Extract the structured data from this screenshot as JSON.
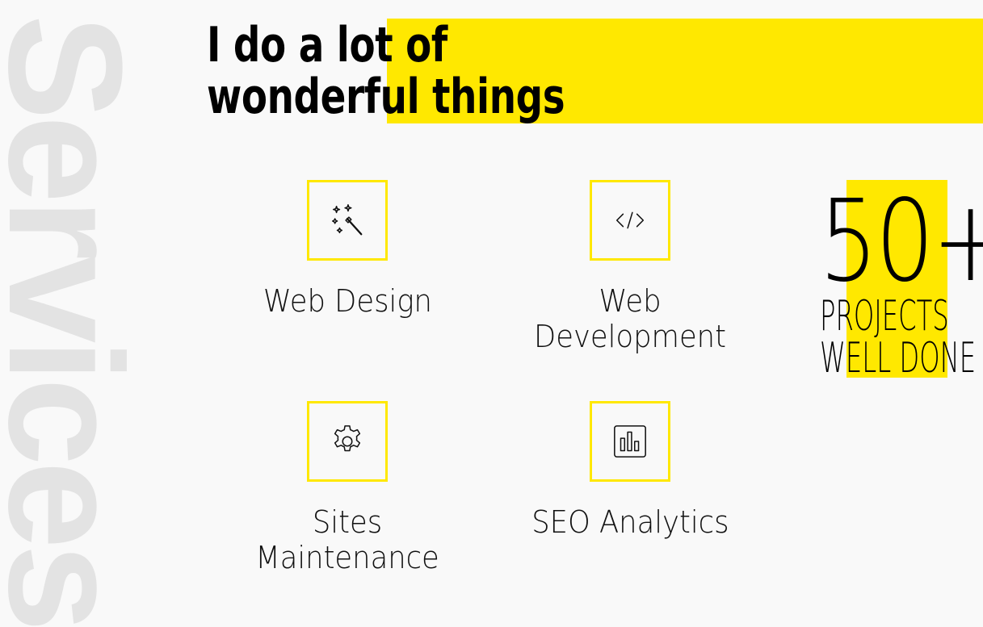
{
  "section": {
    "side_title": "Services",
    "headline": "I do a lot of wonderful things"
  },
  "services": [
    {
      "label": "Web Design",
      "icon": "magic-wand-icon"
    },
    {
      "label": "Web Development",
      "icon": "code-icon"
    },
    {
      "label": "Sites Maintenance",
      "icon": "gear-icon"
    },
    {
      "label": "SEO Analytics",
      "icon": "bar-chart-icon"
    }
  ],
  "stats": {
    "number": "50+",
    "label_line1": "PROJECTS",
    "label_line2": "WELL DONE"
  },
  "colors": {
    "accent": "#ffe800",
    "background": "#f9f9f9",
    "side_title": "#e3e3e3",
    "text": "#111111"
  }
}
